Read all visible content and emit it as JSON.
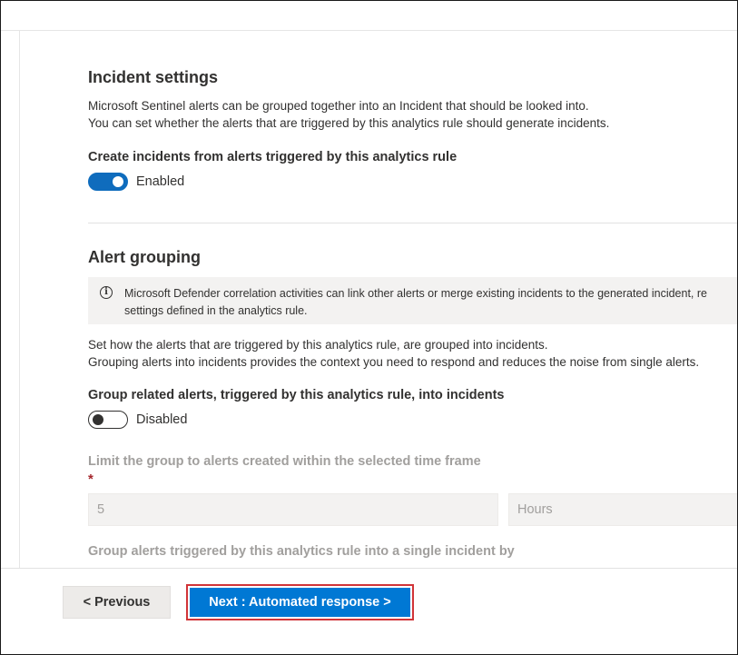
{
  "incident_settings": {
    "title": "Incident settings",
    "description_line1": "Microsoft Sentinel alerts can be grouped together into an Incident that should be looked into.",
    "description_line2": "You can set whether the alerts that are triggered by this analytics rule should generate incidents.",
    "create_incidents_label": "Create incidents from alerts triggered by this analytics rule",
    "create_incidents_state": "Enabled"
  },
  "alert_grouping": {
    "title": "Alert grouping",
    "info_line1": "Microsoft Defender correlation activities can link other alerts or merge existing incidents to the generated incident, re",
    "info_line2": "settings defined in the analytics rule.",
    "description_line1": "Set how the alerts that are triggered by this analytics rule, are grouped into incidents.",
    "description_line2": "Grouping alerts into incidents provides the context you need to respond and reduces the noise from single alerts.",
    "group_related_label": "Group related alerts, triggered by this analytics rule, into incidents",
    "group_related_state": "Disabled",
    "limit_label": "Limit the group to alerts created within the selected time frame",
    "required_marker": "*",
    "time_value": "5",
    "time_unit": "Hours",
    "group_by_label": "Group alerts triggered by this analytics rule into a single incident by"
  },
  "footer": {
    "previous_label": "< Previous",
    "next_label": "Next : Automated response >"
  },
  "colors": {
    "accent": "#0078d4",
    "toggle_on": "#0f6cbd",
    "highlight_border": "#d13438",
    "required": "#a4262c"
  }
}
